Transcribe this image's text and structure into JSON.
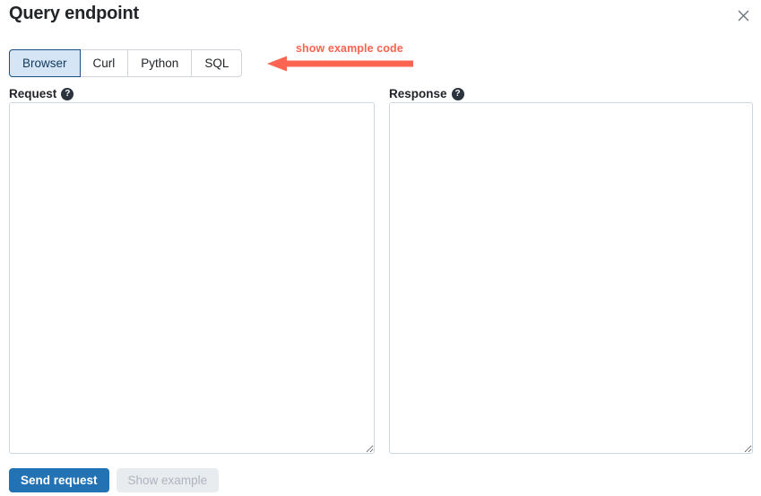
{
  "dialog": {
    "title": "Query endpoint",
    "close_icon": "close-icon",
    "close_label": "Close"
  },
  "tabs": {
    "items": [
      {
        "label": "Browser",
        "active": true
      },
      {
        "label": "Curl",
        "active": false
      },
      {
        "label": "Python",
        "active": false
      },
      {
        "label": "SQL",
        "active": false
      }
    ]
  },
  "annotation": {
    "text": "show example code",
    "color": "#fa6450",
    "direction": "left"
  },
  "request": {
    "label": "Request",
    "help_icon": "help-circle-icon",
    "value": "",
    "placeholder": ""
  },
  "response": {
    "label": "Response",
    "help_icon": "help-circle-icon",
    "value": "",
    "placeholder": ""
  },
  "footer": {
    "send_label": "Send request",
    "show_example_label": "Show example",
    "send_color": "#2272b4",
    "disabled_color": "#e9ecef"
  }
}
